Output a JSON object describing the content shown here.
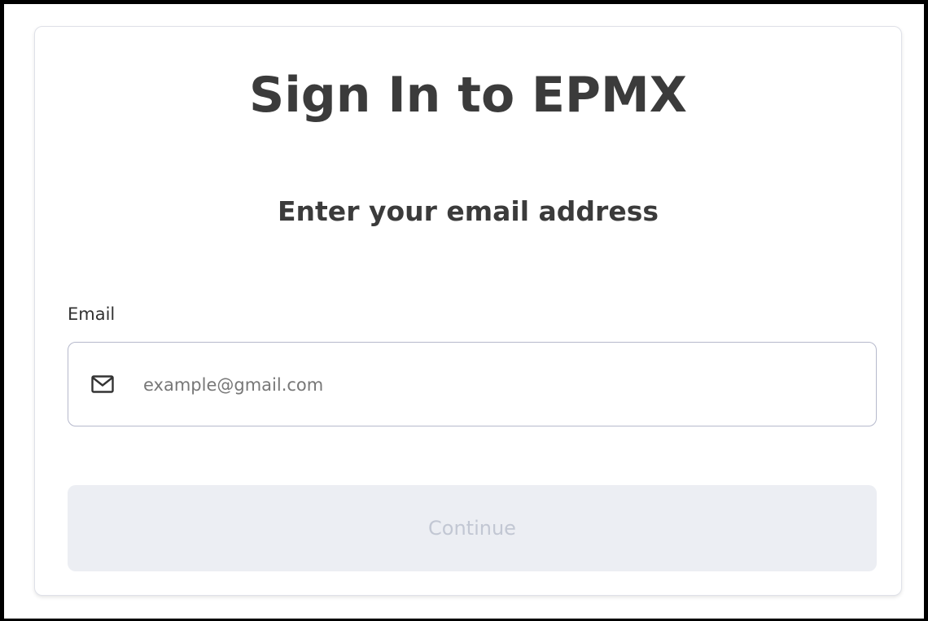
{
  "title": "Sign In to EPMX",
  "subtitle": "Enter your email address",
  "email": {
    "label": "Email",
    "placeholder": "example@gmail.com",
    "value": "",
    "icon": "mail-icon"
  },
  "continue_button": {
    "label": "Continue",
    "state": "disabled"
  },
  "colors": {
    "text": "#3b3b3b",
    "input_border": "#b6b9cc",
    "button_bg_disabled": "#eceef3",
    "button_text_disabled": "#c2c7d3"
  }
}
